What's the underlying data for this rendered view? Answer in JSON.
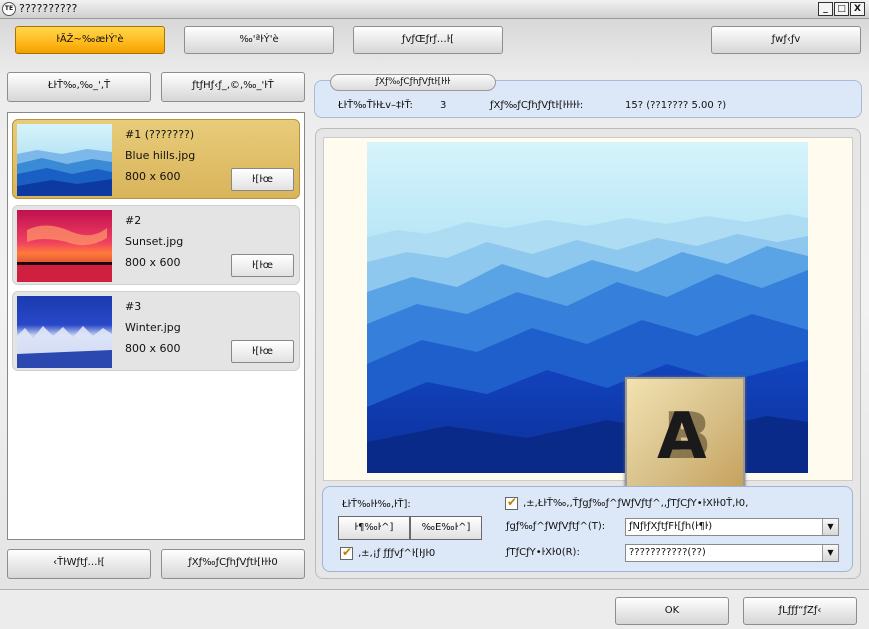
{
  "window": {
    "title": "??????????",
    "app_icon": "TE",
    "controls": {
      "minimize": "_",
      "maximize": "□",
      "close": "X"
    }
  },
  "toolbar": {
    "btn1": "ŀÃŽ~‰æŀÝ'è",
    "btn2": "‰'ªŀÝ'è",
    "btn3": "ƒvƒŒƒrƒ…ŀ[",
    "btn4": "ƒwƒ‹ƒv"
  },
  "left": {
    "btn_top_left": "ŁŀŤ‰‚‰_'‚Ť",
    "btn_top_right": "ƒtƒHƒ‹ƒ_‚©‚‰_'ŀŤ",
    "btn_bottom_left": "‹ŤŀWƒtƒ…ŀ[",
    "btn_bottom_right": "ƒXƒ‰ƒCƒhƒVƒtŀ[ŀŀŀ0"
  },
  "images": [
    {
      "title": "#1 (???????)",
      "filename": "Blue hills.jpg",
      "size": "800 x 600",
      "button": "ŀ[ŀœ",
      "selected": true
    },
    {
      "title": "#2",
      "filename": "Sunset.jpg",
      "size": "800 x 600",
      "button": "ŀ[ŀœ",
      "selected": false
    },
    {
      "title": "#3",
      "filename": "Winter.jpg",
      "size": "800 x 600",
      "button": "ŀ[ŀœ",
      "selected": false
    }
  ],
  "info": {
    "tab": "ƒXƒ‰ƒCƒhƒVƒtŀ[ŀŀŀ",
    "count_label": "ŁŀŤ‰ŤŀŀŁv–‡ŀŤ:",
    "count_value": "3",
    "time_label": "ƒXƒ‰ƒCƒhƒVƒtŀ[ŀŀŀŀŀ:",
    "time_value": "15? (??1???? 5.00 ?)"
  },
  "settings": {
    "order_label": "ŁŀŤ‰ŀŀ‰‚ŀŤ]:",
    "order_btn1": "ŀ¶‰ŀ^]",
    "order_btn2": "‰E‰ŀ^]",
    "loop_label": "‚±‚¡ƒ ƒƒƒvƒ^ŀ[ŀJŀ0",
    "random_label": "‚±‚ŁŀŤ‰‚‚Ťƒgƒ‰ƒ^ƒWƒVƒtƒ^‚‚ƒTƒCƒY•ŀXŀŀ0Ť‚ŀ0‚",
    "transition_label": "ƒgƒ‰ƒ^ƒWƒVƒtƒ^(T):",
    "transition_value": "ƒNƒŀƒXƒtƒFŀ[ƒh(ŀ¶ŀ)",
    "size_label": "ƒTƒCƒY•ŀXŀ0(R):",
    "size_value": "???????????(??)"
  },
  "footer": {
    "ok": "OK",
    "cancel": "ƒLƒƒƒ“ƒZƒ‹"
  },
  "colors": {
    "accent_orange": "#ffb81c",
    "selected_card": "#dcb860",
    "panel_blue": "#dce8f8"
  }
}
